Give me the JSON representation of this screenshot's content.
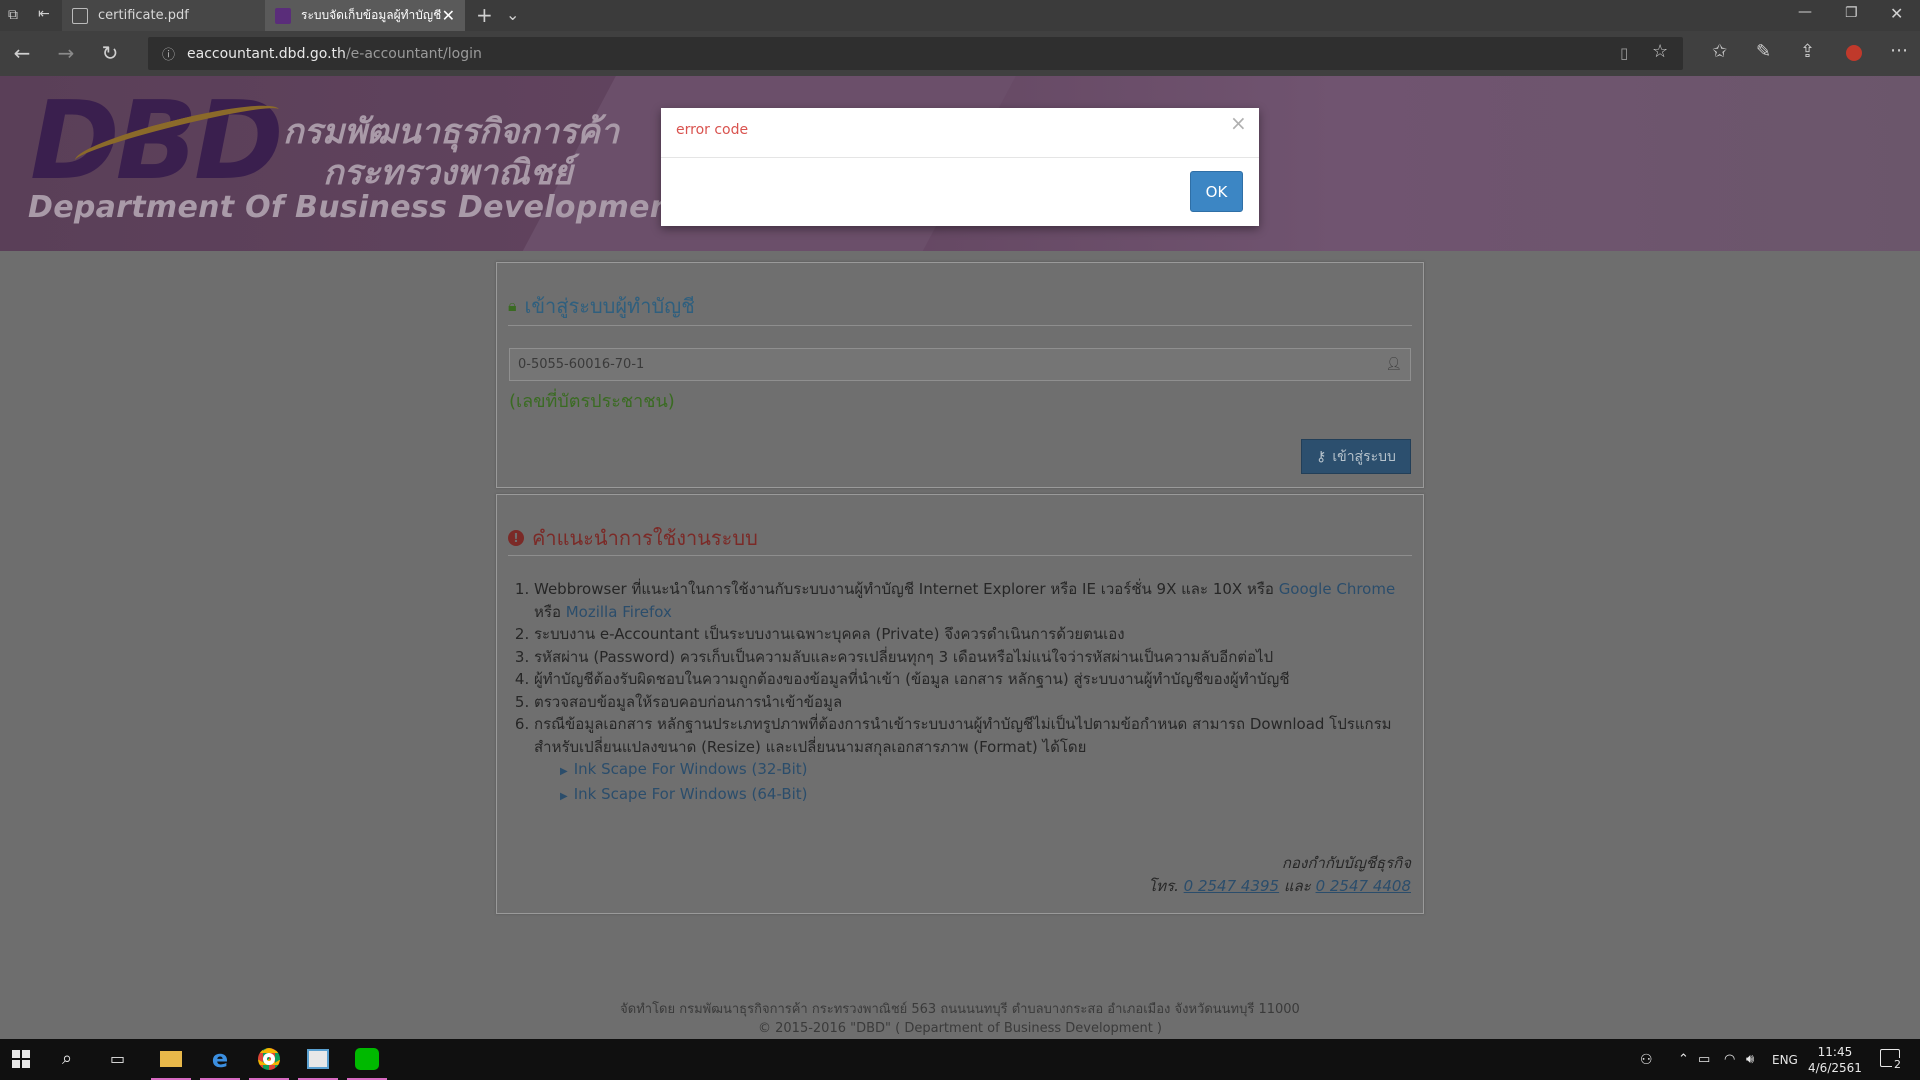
{
  "browser": {
    "tabs": [
      {
        "label": "certificate.pdf"
      },
      {
        "label": "ระบบจัดเก็บข้อมูลผู้ทำบัญชี"
      }
    ],
    "url": {
      "host": "eaccountant.dbd.go.th",
      "path": "/e-accountant/login"
    }
  },
  "banner": {
    "logo_text": "DBD",
    "th_line1": "กรมพัฒนาธุรกิจการค้า",
    "th_line2": "กระทรวงพาณิชย์",
    "en_line": "Department Of Business Development"
  },
  "login": {
    "title": "เข้าสู่ระบบผู้ทำบัญชี",
    "id_value": "0-5055-60016-70-1",
    "id_hint": "(เลขที่บัตรประชาชน)",
    "button_label": "เข้าสู่ระบบ"
  },
  "guide": {
    "title": "คำแนะนำการใช้งานระบบ",
    "item1_text": "Webbrowser ที่แนะนำในการใช้งานกับระบบงานผู้ทำบัญชี Internet Explorer หรือ IE เวอร์ชั่น 9X และ 10X หรือ",
    "item1_link1": "Google Chrome",
    "item1_or": "หรือ",
    "item1_link2": "Mozilla Firefox",
    "item2": "ระบบงาน e-Accountant เป็นระบบงานเฉพาะบุคคล (Private) จึงควรดำเนินการด้วยตนเอง",
    "item3": "รหัสผ่าน (Password) ควรเก็บเป็นความลับและควรเปลี่ยนทุกๆ 3 เดือนหรือไม่แน่ใจว่ารหัสผ่านเป็นความลับอีกต่อไป",
    "item4": "ผู้ทำบัญชีต้องรับผิดชอบในความถูกต้องของข้อมูลที่นำเข้า (ข้อมูล เอกสาร หลักฐาน) สู่ระบบงานผู้ทำบัญชีของผู้ทำบัญชี",
    "item5": "ตรวจสอบข้อมูลให้รอบคอบก่อนการนำเข้าข้อมูล",
    "item6": "กรณีข้อมูลเอกสาร หลักฐานประเภทรูปภาพที่ต้องการนำเข้าระบบงานผู้ทำบัญชีไม่เป็นไปตามข้อกำหนด สามารถ Download โปรแกรม สำหรับเปลี่ยนแปลงขนาด (Resize) และเปลี่ยนนามสกุลเอกสารภาพ (Format) ได้โดย",
    "download1": "Ink Scape For Windows (32-Bit)",
    "download2": "Ink Scape For Windows (64-Bit)",
    "contact_org": "กองกำกับบัญชีธุรกิจ",
    "contact_tel_label": "โทร.",
    "contact_tel1": "0 2547 4395",
    "contact_and": "และ",
    "contact_tel2": "0 2547 4408"
  },
  "footer": {
    "line1": "จัดทำโดย กรมพัฒนาธุรกิจการค้า กระทรวงพาณิชย์ 563 ถนนนนทบุรี ตำบลบางกระสอ อำเภอเมือง จังหวัดนนทบุรี 11000",
    "line2": "© 2015-2016 \"DBD\" ( Department of Business Development )"
  },
  "modal": {
    "title": "error code",
    "ok_label": "OK"
  },
  "taskbar": {
    "lang": "ENG",
    "time": "11:45",
    "date": "4/6/2561",
    "notif_count": "2"
  },
  "colors": {
    "modal_title": "#d9534f",
    "ok_button": "#3c86c4",
    "login_button": "#2c4f6e"
  }
}
